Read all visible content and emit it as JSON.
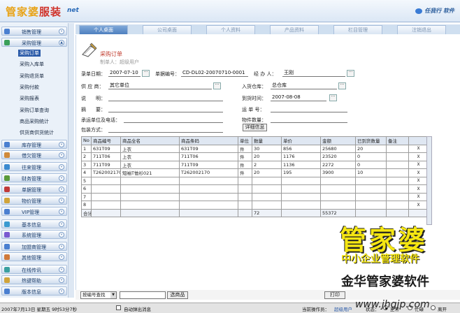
{
  "header": {
    "logo_text_a": "管家婆",
    "logo_text_b": "服装",
    "logo_net": "net",
    "brand": "任我行 软件"
  },
  "sidebar": {
    "sections": [
      {
        "label": "销售管理",
        "icon_color": "#4a7fd0"
      },
      {
        "label": "采购管理",
        "icon_color": "#3aa05a"
      },
      {
        "label": "库存管理",
        "icon_color": "#4a7fd0"
      },
      {
        "label": "借欠管理",
        "icon_color": "#d08a3a"
      },
      {
        "label": "往来管理",
        "icon_color": "#3a8ad0"
      },
      {
        "label": "财务管理",
        "icon_color": "#5a9a3a"
      },
      {
        "label": "单据管理",
        "icon_color": "#c03a3a"
      },
      {
        "label": "物价管理",
        "icon_color": "#d0a43a"
      },
      {
        "label": "VIP管理",
        "icon_color": "#4a7fd0"
      },
      {
        "label": "基本信息",
        "icon_color": "#3a9ad0"
      },
      {
        "label": "系统管理",
        "icon_color": "#7a5ad0"
      },
      {
        "label": "加盟商管理",
        "icon_color": "#4a7fd0"
      },
      {
        "label": "其他管理",
        "icon_color": "#d07a3a"
      },
      {
        "label": "在线传讯",
        "icon_color": "#3aa0a0"
      },
      {
        "label": "热键帮助",
        "icon_color": "#d0a43a"
      },
      {
        "label": "版本信息",
        "icon_color": "#4a7fd0"
      }
    ],
    "purchase_items": [
      "采购订单",
      "采购入库单",
      "采购退货单",
      "采购付款",
      "采购报表",
      "采购订单查询",
      "商品采购统计",
      "供货商供货统计"
    ]
  },
  "tabs": [
    "个人桌面",
    "公司桌面",
    "个人资料",
    "产品资料",
    "栏目管理",
    "注销退出"
  ],
  "form": {
    "title": "采购订单",
    "subtitle": "制单人：超级用户",
    "date_label": "录单日期：",
    "date_value": "2007-07-10",
    "no_label": "单据编号：",
    "no_value": "CD-DL02-20070710-0001",
    "handler_label": "经 办 人：",
    "handler_value": "王刚",
    "supplier_label": "供 应 商：",
    "supplier_value": "其它单位",
    "warehouse_label": "入货仓库：",
    "warehouse_value": "总仓库",
    "note_label": "说　　明：",
    "arrive_label": "到货时间：",
    "arrive_value": "2007-08-08",
    "summary_label": "摘　　要：",
    "waybill_label": "运 单 号：",
    "carrier_label": "承运单位及电话：",
    "qty_label": "物件数量：",
    "pack_label": "包装方式：",
    "detail_btn": "详细信息"
  },
  "grid": {
    "headers": [
      "No",
      "商品编号",
      "商品全名",
      "商品条码",
      "单位",
      "数量",
      "单价",
      "金额",
      "已到货数量",
      "备注",
      ""
    ],
    "rows": [
      [
        "1",
        "631T09",
        "上衣",
        "631T09",
        "件",
        "30",
        "856",
        "25680",
        "20",
        "",
        "X"
      ],
      [
        "2",
        "711T06",
        "上衣",
        "711T06",
        "件",
        "20",
        "1176",
        "23520",
        "0",
        "",
        "X"
      ],
      [
        "3",
        "711T09",
        "上衣",
        "711T09",
        "件",
        "2",
        "1136",
        "2272",
        "0",
        "",
        "X"
      ],
      [
        "4",
        "T262002170",
        "短袖T恤衫021",
        "T262002170",
        "件",
        "20",
        "195",
        "3900",
        "10",
        "",
        "X"
      ],
      [
        "5",
        "",
        "",
        "",
        "",
        "",
        "",
        "",
        "",
        "",
        "X"
      ],
      [
        "6",
        "",
        "",
        "",
        "",
        "",
        "",
        "",
        "",
        "",
        "X"
      ],
      [
        "7",
        "",
        "",
        "",
        "",
        "",
        "",
        "",
        "",
        "",
        "X"
      ],
      [
        "8",
        "",
        "",
        "",
        "",
        "",
        "",
        "",
        "",
        "",
        "X"
      ]
    ],
    "total": {
      "label": "合计",
      "qty": "72",
      "amount": "55372"
    }
  },
  "watermark": {
    "big": "管家婆",
    "small": "中小企业管理软件",
    "cn": "金华管家婆软件",
    "url": "www.jhgjp.com"
  },
  "bottom": {
    "search_mode": "按编号查找",
    "pick_btn": "选商品",
    "print_btn": "打印"
  },
  "status": {
    "datetime": "2007年7月13日 星期五 9时53分7秒",
    "auto_popup": "自动弹出消息",
    "operator_label": "当前操作员：",
    "operator": "超级用户",
    "state_label": "状态：",
    "states": [
      "正常",
      "忙碌",
      "离开"
    ],
    "selected_state": "正常"
  }
}
